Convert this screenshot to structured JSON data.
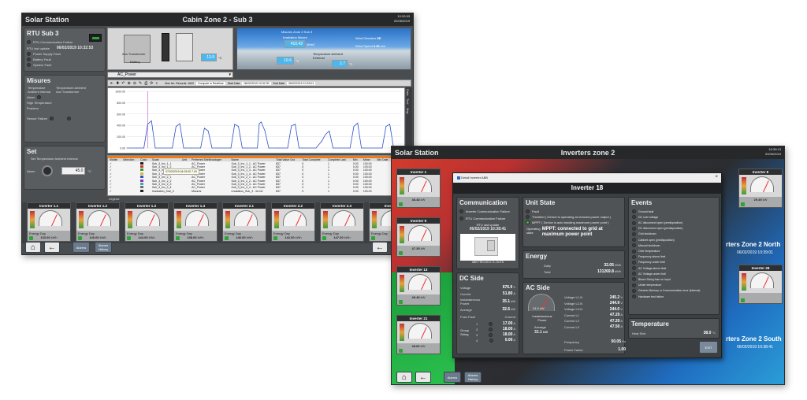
{
  "win1": {
    "app": "Solar Station",
    "title": "Cabin Zone 2 - Sub 3",
    "corner": [
      "10:32:53",
      "02/06/2019"
    ],
    "rtu": {
      "title": "RTU Sub 3",
      "rows": [
        "RTU Communication Failure",
        "Power Supply Fault",
        "Battery Fault",
        "System Fault"
      ],
      "last_update_label": "RTU last update",
      "last_update": "06/02/2019 10:32:53"
    },
    "misures": {
      "title": "Misures",
      "cols": [
        "Temperature Ambient Internal",
        "Temperature Ambient Aux Transformer"
      ],
      "alarm": "Alarm",
      "high_temp": "High Temperature",
      "problem": "Problem",
      "sensor": "Sensor Failure"
    },
    "set": {
      "title": "Set",
      "label": "Set Temperature Ambient Internal",
      "alarm": "Alarm",
      "value": "45.0",
      "unit": "°C"
    },
    "diagram": {
      "device_labels": [
        "Aux Transformer",
        "Battery"
      ],
      "temp_value": "13.9",
      "temp_unit": "°C"
    },
    "sky": {
      "mqa": "Misures Zone 2 Sub 3",
      "irr_label": "Irradiation Misure",
      "irr_value": "410.42",
      "irr_unit": "W/m2",
      "wind_dir_label": "Wind Direction",
      "wind_dir_value": "SE",
      "wind_speed_label": "Wind Speed",
      "wind_speed_value": "0.56",
      "wind_unit": "m/s",
      "temp1_value": "19.6",
      "temp1_unit": "°C",
      "temp2_label": "Temperature Ambient External",
      "temp2_value": "2.7",
      "temp2_unit": "°C"
    },
    "select_label": "AC_Power",
    "toolbar_texts": [
      "Max No. Records: 1600",
      "Compute in Realtime",
      "Start Date",
      "06/02/2019 10:32:30",
      "End Date",
      "06/02/2019 10:33:01"
    ],
    "chart_side": [
      "Data",
      "Tool",
      "Map"
    ],
    "chart_data": {
      "type": "line",
      "title": "",
      "xlabel": "",
      "ylabel": "",
      "yticks": [
        "1000.00",
        "800.00",
        "600.00",
        "400.00",
        "200.00",
        "0.00"
      ],
      "ylim": [
        0,
        1000
      ],
      "x": [
        0,
        10,
        18,
        22,
        26,
        30,
        38,
        48,
        52,
        56,
        60,
        68,
        78,
        82,
        86,
        90,
        100,
        110,
        114,
        118,
        122,
        128,
        138,
        140,
        142,
        146,
        150,
        160,
        170,
        174,
        178,
        182,
        190,
        200,
        206,
        210,
        214,
        218,
        226,
        236,
        240,
        244,
        248,
        256,
        270,
        274,
        278,
        282,
        290
      ],
      "y": [
        0,
        0,
        0,
        420,
        480,
        0,
        0,
        0,
        380,
        430,
        0,
        0,
        0,
        350,
        300,
        0,
        0,
        0,
        420,
        380,
        0,
        0,
        0,
        430,
        460,
        300,
        0,
        0,
        0,
        390,
        420,
        0,
        0,
        0,
        120,
        240,
        300,
        0,
        0,
        0,
        380,
        440,
        0,
        0,
        0,
        380,
        420,
        0,
        0
      ]
    },
    "table": {
      "headers": [
        "Visible",
        "Selection",
        "Color",
        "Scale",
        "Unit",
        "Preferred SiteBroadager",
        "Name",
        "Total Value Out",
        "Total Complete",
        "Complete Last",
        "Min",
        "Mean",
        "Min Date",
        "Max Date"
      ],
      "rows": [
        [
          "✓",
          "",
          "#1a1a1a",
          "Sub_3_Inv_1_1",
          "",
          "AC_Power",
          "Sub_3_Inv_1_1 - AC Power",
          "837",
          "0",
          "1",
          "0.00",
          "100.00",
          "",
          ""
        ],
        [
          "✓",
          "",
          "#d12d2d",
          "Sub_3_Inv_1_2",
          "",
          "AC_Power",
          "Sub_3_Inv_1_2 - AC Power",
          "837",
          "0",
          "1",
          "0.00",
          "100.00",
          "",
          ""
        ],
        [
          "✓",
          "",
          "#2f9c2f",
          "Sub_3_Inv_1_3",
          "",
          "AC_Power",
          "Sub_3_Inv_1_3 - AC Power",
          "837",
          "0",
          "1",
          "0.00",
          "100.00",
          "",
          ""
        ],
        [
          "✓",
          "",
          "#e0b02a",
          "Sub_3_Inv_1_4",
          "",
          "AC_Power",
          "Sub_3_Inv_1_4 - AC Power",
          "837",
          "0",
          "1",
          "0.00",
          "100.00",
          "",
          ""
        ],
        [
          "✓",
          "",
          "#2a52c8",
          "Sub_3_Inv_2_1",
          "",
          "AC_Power",
          "Sub_3_Inv_2_1 - AC Power",
          "837",
          "0",
          "1",
          "0.00",
          "100.00",
          "",
          ""
        ],
        [
          "✓",
          "",
          "#9a2fb0",
          "Sub_3_Inv_2_2",
          "",
          "AC_Power",
          "Sub_3_Inv_2_2 - AC Power",
          "837",
          "0",
          "1",
          "0.00",
          "100.00",
          "",
          ""
        ],
        [
          "✓",
          "",
          "#2fb0b0",
          "Sub_3_Inv_2_3",
          "",
          "AC_Power",
          "Sub_3_Inv_2_3 - AC Power",
          "837",
          "0",
          "1",
          "0.00",
          "100.00",
          "",
          ""
        ],
        [
          "✓",
          "",
          "#6d6d6d",
          "Sub_3_Inv_2_4",
          "",
          "AC_Power",
          "Sub_3_Inv_2_4 - AC Power",
          "837",
          "0",
          "1",
          "0.00",
          "100.00",
          "",
          ""
        ],
        [
          "✓",
          "",
          "#222222",
          "Irradiation_Sub_3",
          "",
          "Misures",
          "Irradiation_Sub_3 - W-m2",
          "837",
          "0",
          "1",
          "0.00",
          "100.00",
          "",
          ""
        ]
      ],
      "tooltip": "07/03/2019 04:03:00  7.00",
      "legend": "Legend"
    },
    "inverters": [
      {
        "name": "Inverter 1.1",
        "value": "133.00",
        "unit": "kWh"
      },
      {
        "name": "Inverter 1.2",
        "value": "140.00",
        "unit": "kWh"
      },
      {
        "name": "Inverter 1.3",
        "value": "144.00",
        "unit": "kWh"
      },
      {
        "name": "Inverter 1.4",
        "value": "138.00",
        "unit": "kWh"
      },
      {
        "name": "Inverter 2.1",
        "value": "146.00",
        "unit": "kWh"
      },
      {
        "name": "Inverter 2.2",
        "value": "142.00",
        "unit": "kWh"
      },
      {
        "name": "Inverter 2.3",
        "value": "147.00",
        "unit": "kWh"
      },
      {
        "name": "Inverter",
        "value": "",
        "unit": ""
      }
    ],
    "energy_label": "Energy Day",
    "alarms_btn": "Alarms",
    "history_btn": "Alarms History"
  },
  "win2": {
    "app": "Solar Station",
    "title": "Inverters zone 2",
    "corner": [
      "10:39:13",
      "02/06/2019"
    ],
    "left_inverters": [
      {
        "name": "Inverter 1",
        "value": "48.48",
        "unit": "kW"
      },
      {
        "name": "Inverter 9",
        "value": "47.35",
        "unit": "kW"
      },
      {
        "name": "Inverter 13",
        "value": "48.48",
        "unit": "kW"
      },
      {
        "name": "Inverter 21",
        "value": "48.66",
        "unit": "kW"
      }
    ],
    "right_inverters": [
      {
        "name": "Inverter 8",
        "value": "29.49",
        "unit": "kW"
      },
      {
        "name": "Inverter 28",
        "value": "",
        "unit": ""
      }
    ],
    "zone_north": "rters Zone 2 North",
    "zone_north_date": "06/02/2019 10:39:01",
    "zone_south": "rters Zone 2 South",
    "zone_south_date": "06/02/2019 10:38:41",
    "alarms_btn": "Alarms",
    "history_btn": "Alarms History"
  },
  "dialog": {
    "window_label": "Detail Inverter ABB",
    "title": "Inverter 18",
    "communication": {
      "title": "Communication",
      "rows": [
        "Inverter Communication Failure",
        "RTU Communication Failure"
      ],
      "last_update_label": "RTU last update",
      "last_update": "06/02/2019 10:38:41",
      "device": "ABB TRIO-50.0-TL-OUTD"
    },
    "unit_state": {
      "title": "Unit State",
      "rows": [
        "Fault",
        "Throttled ( Device is operating at reduced power output )",
        "MPPT ( Device is auto tracking maximum power point )"
      ],
      "op_label": "Operating state",
      "op_value": "MPPT: connected to grid at maximum power point"
    },
    "energy": {
      "title": "Energy",
      "daily_label": "Daily",
      "daily_value": "32.05",
      "daily_unit": "kWh",
      "total_label": "Total",
      "total_value": "131269.8",
      "total_unit": "kWh"
    },
    "dc": {
      "title": "DC Side",
      "voltage_label": "Voltage",
      "voltage": "676.9",
      "voltage_unit": "V",
      "current_label": "Current",
      "current": "51.80",
      "current_unit": "A",
      "power_label": "Instantaneous Power",
      "power": "35.1",
      "power_unit": "kW",
      "avg_label": "Average",
      "avg": "32.6",
      "avg_unit": "kW",
      "fuse_label": "Fuse Fault",
      "current_col": "Current",
      "group_label": "Group String",
      "strings": [
        {
          "n": "1",
          "v": "17.00",
          "u": "A"
        },
        {
          "n": "2",
          "v": "18.00",
          "u": "A"
        },
        {
          "n": "3",
          "v": "18.00",
          "u": "A"
        },
        {
          "n": "4",
          "v": "0.00",
          "u": "A"
        }
      ]
    },
    "ac": {
      "title": "AC Side",
      "gauge_value": "34.5",
      "gauge_unit": "kW",
      "inst_label": "Instantaneous Power",
      "avg_label": "Average",
      "avg": "32.1",
      "avg_unit": "kW",
      "rows": [
        {
          "l": "Voltage L1-N",
          "v": "245.2",
          "u": "V"
        },
        {
          "l": "Voltage L2-N",
          "v": "244.9",
          "u": "V"
        },
        {
          "l": "Voltage L3-N",
          "v": "244.0",
          "u": "V"
        },
        {
          "l": "Current L1",
          "v": "47.20",
          "u": "A"
        },
        {
          "l": "Current L2",
          "v": "47.20",
          "u": "A"
        },
        {
          "l": "Current L3",
          "v": "47.50",
          "u": "A"
        }
      ],
      "freq_label": "Frequency",
      "freq": "50.05",
      "freq_unit": "Hz",
      "pf_label": "Power Factor",
      "pf": "1.00"
    },
    "events": {
      "title": "Events",
      "rows": [
        "Ground fault",
        "DC over voltage",
        "AC disconnect open (predisposition)",
        "DC disconnect open (predisposition)",
        "Grid shutdown",
        "Cabinet open (predisposition)",
        "Manual shutdown",
        "Over temperature",
        "Frequency above limit",
        "Frequency under limit",
        "AC Voltage above limit",
        "AC Voltage under limit",
        "Blown String fuse on input",
        "Under temperature",
        "Generic Memory or Communication error (internal)",
        "Hardware test failure"
      ]
    },
    "temperature": {
      "title": "Temperature",
      "label": "Heat Sink",
      "value": "38.0",
      "unit": "°C"
    },
    "exit": "EXIT"
  }
}
